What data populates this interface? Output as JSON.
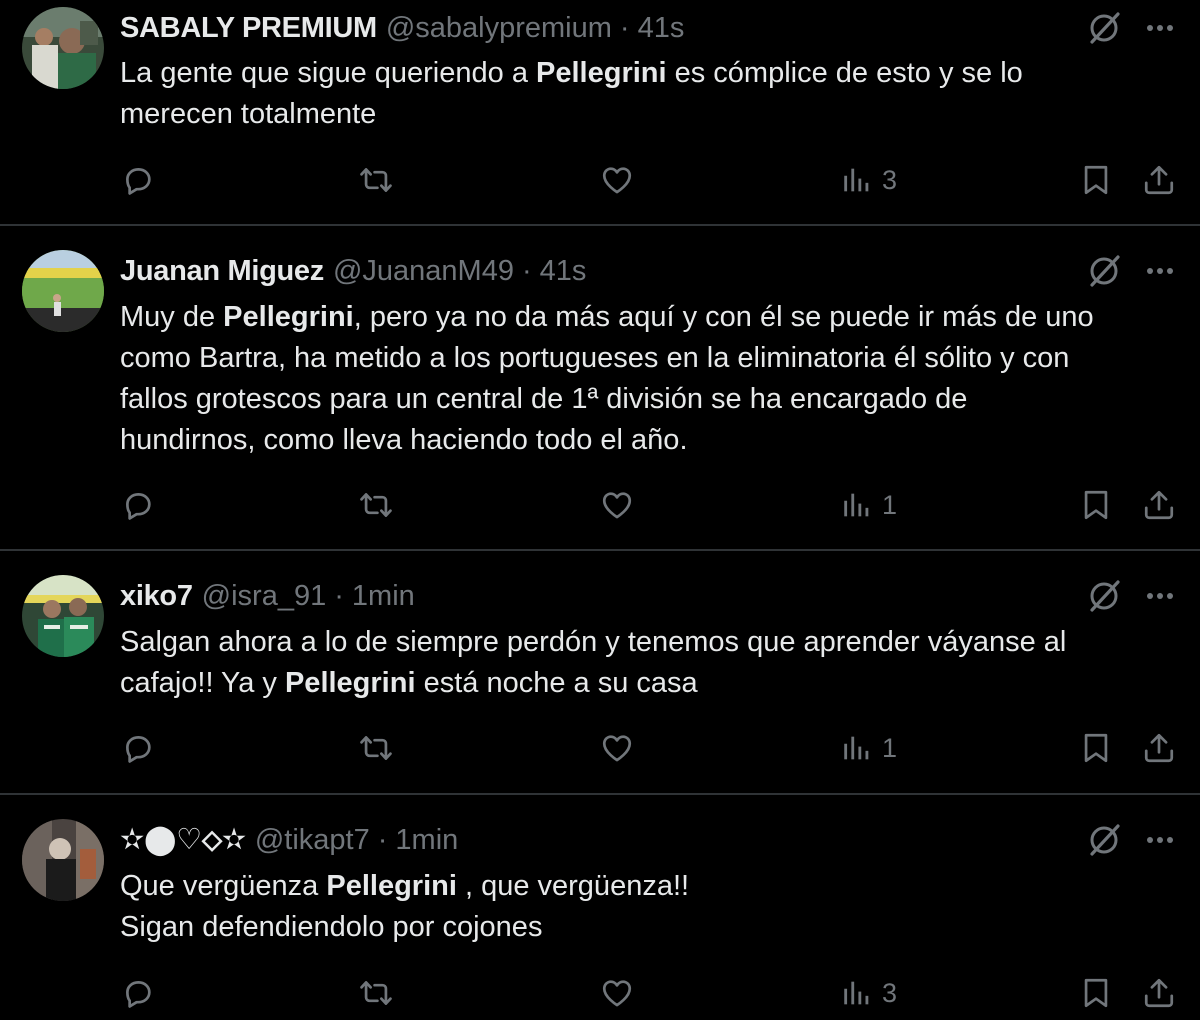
{
  "tweets": [
    {
      "name": "SABALY PREMIUM",
      "handle": "@sabalypremium",
      "separator": "·",
      "time": "41s",
      "text_parts": [
        "La gente que sigue queriendo a ",
        "Pellegrini",
        " es cómplice de esto y se lo\nmerecen totalmente"
      ],
      "views": "3"
    },
    {
      "name": "Juanan Miguez",
      "handle": "@JuananM49",
      "separator": "·",
      "time": "41s",
      "text_parts": [
        "Muy de ",
        "Pellegrini",
        ", pero ya no da más aquí y con él se puede ir más de uno\ncomo Bartra, ha metido a los portugueses en la eliminatoria él sólito y con\nfallos grotescos para un central de 1ª división se ha encargado de\nhundirnos, como lleva haciendo todo el año."
      ],
      "views": "1"
    },
    {
      "name": "xiko7",
      "handle": "@isra_91",
      "separator": "·",
      "time": "1min",
      "text_parts": [
        "Salgan ahora a lo de siempre perdón y tenemos que aprender váyanse al\ncafajo!! Ya y ",
        "Pellegrini",
        " está noche a su casa"
      ],
      "views": "1"
    },
    {
      "name": "✫⬤♡⬦✫",
      "handle": "@tikapt7",
      "separator": "·",
      "time": "1min",
      "text_parts": [
        "Que vergüenza ",
        "Pellegrini",
        " , que vergüenza!!\nSigan defendiendolo por cojones"
      ],
      "views": "3"
    }
  ],
  "icons": {
    "reply": "reply-icon",
    "repost": "repost-icon",
    "like": "heart-icon",
    "views": "views-icon",
    "bookmark": "bookmark-icon",
    "share": "share-icon",
    "grok": "grok-icon",
    "more": "more-icon"
  },
  "colors": {
    "background": "#000000",
    "text": "#e7e9ea",
    "secondary": "#71767b",
    "divider": "#2f3336"
  }
}
